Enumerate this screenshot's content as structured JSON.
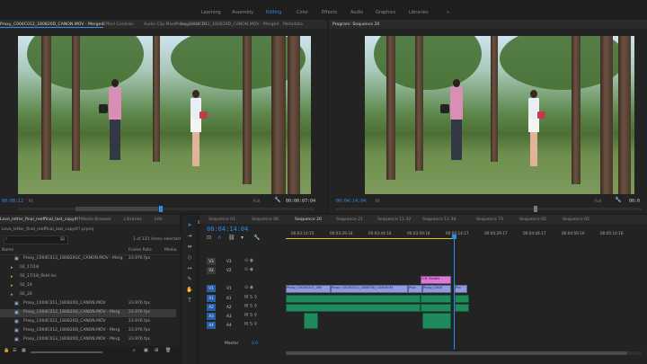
{
  "workspaces": [
    "Learning",
    "Assembly",
    "Editing",
    "Color",
    "Effects",
    "Audio",
    "Graphics",
    "Libraries"
  ],
  "active_workspace": "Editing",
  "more_icon": "»",
  "source_panel": {
    "tabs": [
      "Proxy_C004C012_180820D_CANON.MOV - Merged",
      "Effect Controls",
      "Audio Clip Mixer: Sequence 20",
      "Proxy_C004C012_180820D_CANON.MOV - Merged",
      "Metadata"
    ],
    "timecode_left": "00:08:12",
    "fit": "Fit",
    "timecode_right": "00:00:07:04"
  },
  "program_panel": {
    "title": "Program: Sequence 20",
    "timecode_left": "00:04:14:04",
    "fit": "Fit",
    "quality": "Full",
    "timecode_right": "00:0"
  },
  "source_quality": "Full",
  "project_panel": {
    "tabs": [
      "Love_letter_final_reeffinal_last_copy4!!",
      "Media Browser",
      "Libraries",
      "Info"
    ],
    "path": "Love_letter_final_reeffinal_last_copy4!!.prproj",
    "items_selected": "1 of 121 items selected",
    "col_name": "Name",
    "col_fps": "Frame Rate",
    "col_media": "Media",
    "rows": [
      {
        "name": "Proxy_C004C013_180820GC_CANON.MOV - Merg",
        "fps": "23.976 fps",
        "sel": false
      },
      {
        "name": "02_17/18",
        "fps": "",
        "sel": false
      },
      {
        "name": "02_17/18_field ins",
        "fps": "",
        "sel": false
      },
      {
        "name": "02_19",
        "fps": "",
        "sel": false
      },
      {
        "name": "02_20",
        "fps": "",
        "sel": false
      },
      {
        "name": "Proxy_C004C011_180820D_CANON.MOV",
        "fps": "23.976 fps",
        "sel": false
      },
      {
        "name": "Proxy_C004C012_180820D_CANON.MOV - Merg",
        "fps": "23.976 fps",
        "sel": true
      },
      {
        "name": "Proxy_C004C011_180820D_CANON.MOV",
        "fps": "23.976 fps",
        "sel": false
      },
      {
        "name": "Proxy_C004C012_180820D_CANON.MOV - Merg",
        "fps": "23.976 fps",
        "sel": false
      },
      {
        "name": "Proxy_C004C013_180820D_CANON.MOV - Merg",
        "fps": "23.976 fps",
        "sel": false
      }
    ]
  },
  "timeline": {
    "sequence_tabs": [
      "Sequence 01",
      "Sequence 06",
      "Sequence 20",
      "Sequence 21",
      "Sequence 11-32",
      "Sequence 11-34",
      "Sequence 73",
      "Sequence 05",
      "Sequence 02"
    ],
    "active_sequence": "Sequence 20",
    "timecode": "00:04:14:04",
    "ruler": [
      "00:03:14:15",
      "00:03:29:18",
      "00:03:44:16",
      "00:03:59:18",
      "00:04:14:17",
      "00:04:29:17",
      "00:04:44:17",
      "00:04:59:16",
      "00:05:14:16"
    ],
    "video_tracks": [
      "V3",
      "V2",
      "V1"
    ],
    "audio_tracks": [
      "A1",
      "A2",
      "A3",
      "A4"
    ],
    "master_label": "Master",
    "master_value": "0.0",
    "clips": {
      "v1": [
        "Proxy_C004C013_180",
        "Proxy_C004C012_180820D_CANON.M",
        "Prox",
        "Proxy_C004",
        "Pro"
      ],
      "fx": "G.R Visuals"
    }
  }
}
